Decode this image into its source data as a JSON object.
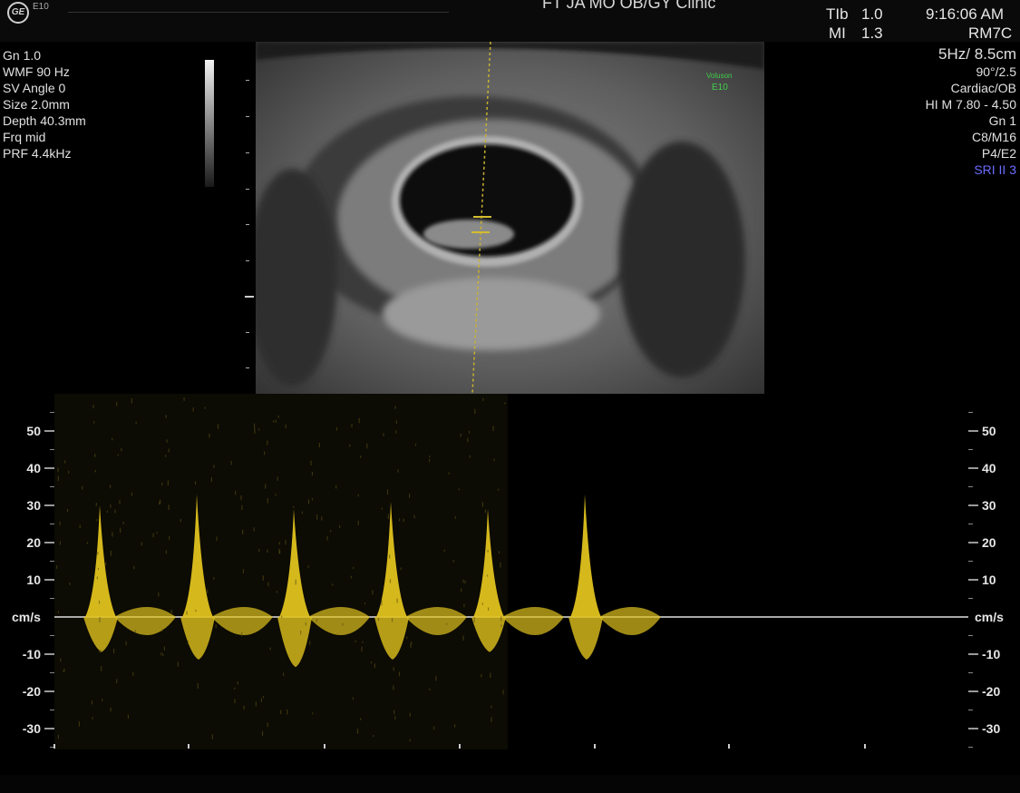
{
  "header": {
    "logo": "GE",
    "model": "E10",
    "clinic": "FT JA MO OB/GY Clinic",
    "tib_label": "TIb",
    "tib_value": "1.0",
    "mi_label": "MI",
    "mi_value": "1.3",
    "time": "9:16:06 AM",
    "probe": "RM7C"
  },
  "left_params": [
    "Gn 1.0",
    "WMF 90 Hz",
    "SV Angle 0",
    "Size 2.0mm",
    "Depth 40.3mm",
    "Frq mid",
    "PRF 4.4kHz"
  ],
  "right_params": {
    "rate_depth": "5Hz/ 8.5cm",
    "angle": "90°/2.5",
    "preset": "Cardiac/OB",
    "him": "HI M 7.80 - 4.50",
    "gain": "Gn 1",
    "map": "C8/M16",
    "power": "P4/E2",
    "sri": "SRI II 3"
  },
  "bmode_watermark": {
    "line1": "Voluson",
    "line2": "E10"
  },
  "doppler": {
    "unit": "cm/s",
    "ticks": [
      50,
      40,
      30,
      20,
      10,
      -10,
      -20,
      -30
    ],
    "baseline": 0,
    "range": [
      -35,
      55
    ]
  },
  "colors": {
    "background": "#000000",
    "spectrum": "#e0c21e",
    "text": "#e6e6e6",
    "sri": "#6a6cff",
    "watermark": "#3fcf4a"
  },
  "chart_data": {
    "type": "area",
    "title": "",
    "xlabel": "",
    "ylabel": "cm/s",
    "ylim": [
      -35,
      55
    ],
    "peak_velocities": [
      30,
      33,
      29,
      31,
      29,
      33
    ],
    "trough_velocities": [
      -8,
      -10,
      -12,
      -10,
      -8,
      -10
    ],
    "grid": false
  }
}
